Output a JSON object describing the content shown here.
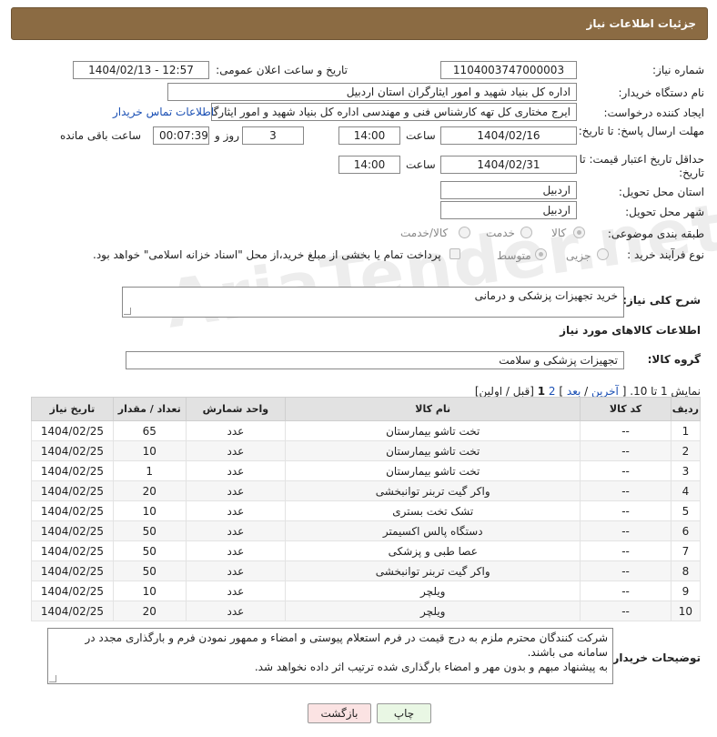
{
  "header": {
    "title": "جزئیات اطلاعات نیاز"
  },
  "fields": {
    "need_number_label": "شماره نیاز:",
    "need_number": "1104003747000003",
    "announce_label": "تاریخ و ساعت اعلان عمومی:",
    "announce_value": "1404/02/13 - 12:57",
    "buyer_org_label": "نام دستگاه خریدار:",
    "buyer_org": "اداره کل بنیاد شهید و امور ایثارگران استان اردبیل",
    "creator_label": "ایجاد کننده درخواست:",
    "creator": "ایرج مختاری کل تهه کارشناس فنی و مهندسی اداره کل بنیاد شهید و امور ایثارگران",
    "contact_link": "اطلاعات تماس خریدار",
    "reply_deadline_label": "مهلت ارسال پاسخ: تا تاریخ:",
    "reply_date": "1404/02/16",
    "time_label": "ساعت",
    "reply_time": "14:00",
    "days_value": "3",
    "days_label": "روز و",
    "remaining_value": "00:07:39",
    "remaining_label": "ساعت باقی مانده",
    "price_deadline_label": "حداقل تاریخ اعتبار قیمت: تا تاریخ:",
    "price_date": "1404/02/31",
    "price_time": "14:00",
    "delivery_province_label": "استان محل تحویل:",
    "delivery_province": "اردبیل",
    "delivery_city_label": "شهر محل تحویل:",
    "delivery_city": "اردبیل",
    "category_label": "طبقه بندی موضوعی:",
    "category_options": [
      "کالا",
      "خدمت",
      "کالا/خدمت"
    ],
    "process_label": "نوع فرآیند خرید :",
    "process_options": [
      "جزیی",
      "متوسط"
    ],
    "payment_note": "پرداخت تمام یا بخشی از مبلغ خرید،از محل \"اسناد خزانه اسلامی\" خواهد بود."
  },
  "summary": {
    "label": "شرح کلی نیاز:",
    "value": "خرید تجهیزات پزشکی و درمانی"
  },
  "goods_section_title": "اطلاعات کالاهای مورد نیاز",
  "goods_group": {
    "label": "گروه کالا:",
    "value": "تجهیزات پزشکی و سلامت"
  },
  "pagination": {
    "showing": "نمایش 1 تا 10.",
    "open_bracket": "[",
    "last": "آخرین",
    "sep1": "/",
    "next": "بعد",
    "close_bracket": "]",
    "pages_current": "1",
    "pages_other": "2",
    "tail": "[قبل / اولین]"
  },
  "table": {
    "headers": [
      "ردیف",
      "کد کالا",
      "نام کالا",
      "واحد شمارش",
      "تعداد / مقدار",
      "تاریخ نیاز"
    ],
    "rows": [
      [
        "1",
        "--",
        "تخت تاشو بیمارستان",
        "عدد",
        "65",
        "1404/02/25"
      ],
      [
        "2",
        "--",
        "تخت تاشو بیمارستان",
        "عدد",
        "10",
        "1404/02/25"
      ],
      [
        "3",
        "--",
        "تخت تاشو بیمارستان",
        "عدد",
        "1",
        "1404/02/25"
      ],
      [
        "4",
        "--",
        "واکر گیت تربنر توانبخشی",
        "عدد",
        "20",
        "1404/02/25"
      ],
      [
        "5",
        "--",
        "تشک تخت بستری",
        "عدد",
        "10",
        "1404/02/25"
      ],
      [
        "6",
        "--",
        "دستگاه پالس اکسیمتر",
        "عدد",
        "50",
        "1404/02/25"
      ],
      [
        "7",
        "--",
        "عصا طبی و پزشکی",
        "عدد",
        "50",
        "1404/02/25"
      ],
      [
        "8",
        "--",
        "واکر گیت تربنر توانبخشی",
        "عدد",
        "50",
        "1404/02/25"
      ],
      [
        "9",
        "--",
        "ویلچر",
        "عدد",
        "10",
        "1404/02/25"
      ],
      [
        "10",
        "--",
        "ویلچر",
        "عدد",
        "20",
        "1404/02/25"
      ]
    ]
  },
  "notes": {
    "label": "توضیحات خریدار:",
    "line1": "شرکت کنندگان محترم ملزم به درج قیمت در فرم استعلام پیوستی و امضاء و ممهور نمودن فرم و بارگذاری مجدد در سامانه می باشند.",
    "line2": "به پیشنهاد مبهم و بدون مهر و امضاء بارگذاری شده ترتیب اثر داده نخواهد شد."
  },
  "buttons": {
    "print": "چاپ",
    "back": "بازگشت"
  },
  "watermark": "AriaTender.net"
}
